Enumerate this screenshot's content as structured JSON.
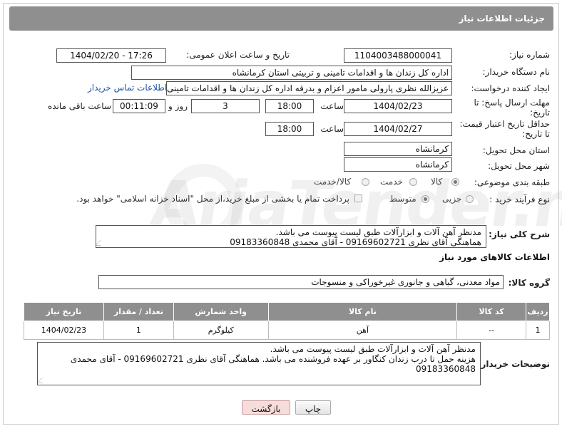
{
  "header": {
    "title": "جزئیات اطلاعات نیاز"
  },
  "fields": {
    "need_number_label": "شماره نیاز:",
    "need_number": "1104003488000041",
    "announce_label": "تاریخ و ساعت اعلان عمومی:",
    "announce_value": "1404/02/20 - 17:26",
    "buyer_org_label": "نام دستگاه خریدار:",
    "buyer_org": "اداره کل زندان ها و اقدامات تامینی و تربیتی استان کرمانشاه",
    "requester_label": "ایجاد کننده درخواست:",
    "requester": "عزیزالله نظری پارولی مامور اعزام و بدرقه اداره کل زندان ها و اقدامات تامینی و تربیتی",
    "contact_link": "اطلاعات تماس خریدار",
    "deadline_label_1": "مهلت ارسال پاسخ: تا",
    "deadline_label_2": "تاریخ:",
    "deadline_date": "1404/02/23",
    "time_label": "ساعت",
    "deadline_time": "18:00",
    "days_value": "3",
    "days_label": "روز و",
    "remaining_time": "00:11:09",
    "remaining_label": "ساعت باقی مانده",
    "validity_label_1": "حداقل تاریخ اعتبار قیمت:",
    "validity_label_2": "تا تاریخ:",
    "validity_date": "1404/02/27",
    "validity_time": "18:00",
    "province_label": "استان محل تحویل:",
    "province": "کرمانشاه",
    "city_label": "شهر محل تحویل:",
    "city": "کرمانشاه",
    "category_label": "طبقه بندی موضوعی:",
    "category_options": [
      "کالا",
      "خدمت",
      "کالا/خدمت"
    ],
    "category_selected": "کالا",
    "process_label": "نوع فرآیند خرید :",
    "process_options": [
      "جزیی",
      "متوسط"
    ],
    "process_selected": "متوسط",
    "payment_note": "پرداخت تمام یا بخشی از مبلغ خرید،از محل \"اسناد خزانه اسلامی\" خواهد بود."
  },
  "description": {
    "label": "شرح کلی نیاز:",
    "lines": [
      "مدنظر آهن آلات و ابزارآلات طبق لیست پیوست می باشد.",
      "هماهنگی آقای نظری 09169602721 - آقای محمدی 09183360848"
    ]
  },
  "goods_section_title": "اطلاعات کالاهای مورد نیاز",
  "goods_group": {
    "label": "گروه کالا:",
    "value": "مواد معدنی، گیاهی و جانوری غیرخوراکی و منسوجات"
  },
  "table": {
    "headers": [
      "ردیف",
      "کد کالا",
      "نام کالا",
      "واحد شمارش",
      "تعداد / مقدار",
      "تاریخ نیاز"
    ],
    "rows": [
      [
        "1",
        "--",
        "آهن",
        "کیلوگرم",
        "1",
        "1404/02/23"
      ]
    ]
  },
  "buyer_notes": {
    "label": "توضیحات خریدار:",
    "lines": [
      "مدنظر آهن آلات و ابزارآلات طبق لیست پیوست می باشد.",
      "هزینه حمل تا درب زندان کنگاور بر عهده فروشنده می باشد. هماهنگی آقای نظری 09169602721 - آقای محمدی",
      "09183360848"
    ]
  },
  "buttons": {
    "print": "چاپ",
    "back": "بازگشت"
  },
  "watermark": "AriaTender.neT"
}
